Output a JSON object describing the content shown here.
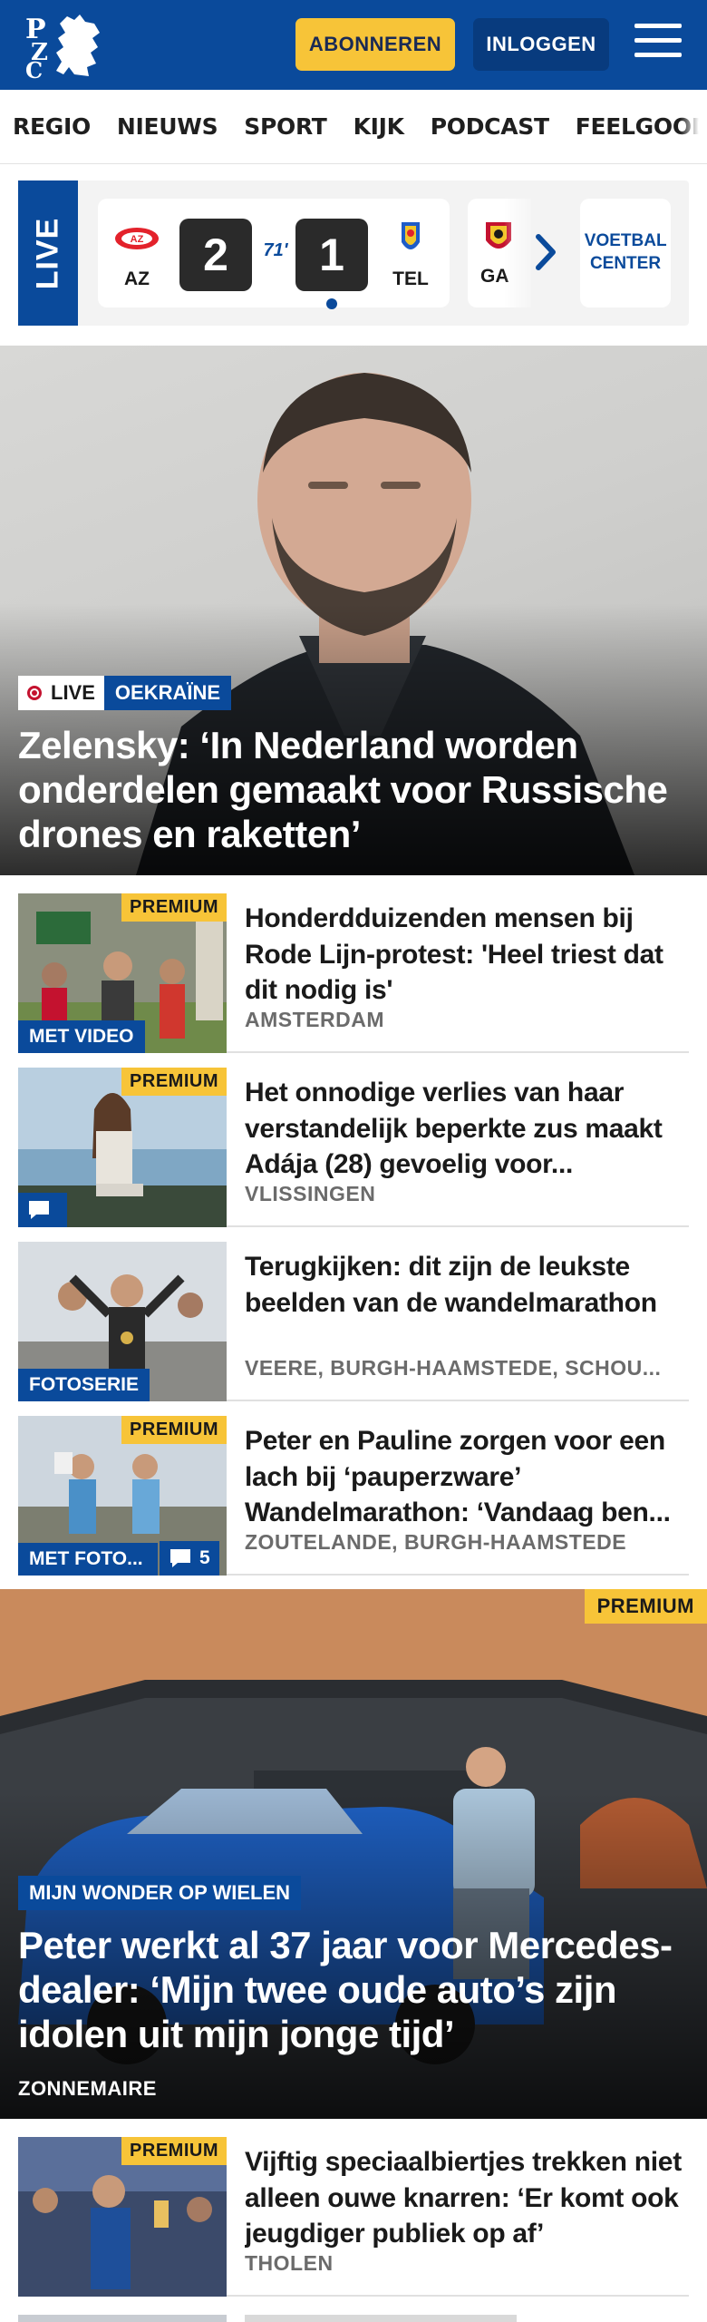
{
  "header": {
    "logo_text": "PZC",
    "subscribe_label": "ABONNEREN",
    "login_label": "INLOGGEN",
    "menu_icon": "hamburger-menu-icon"
  },
  "nav": {
    "items": [
      "REGIO",
      "NIEUWS",
      "SPORT",
      "KIJK",
      "PODCAST",
      "FEELGOOD"
    ]
  },
  "live_strip": {
    "tab_label": "LIVE",
    "match": {
      "home_abbr": "AZ",
      "home_score": "2",
      "minute": "71'",
      "away_score": "1",
      "away_abbr": "TEL"
    },
    "next_match_abbr": "GA",
    "next_icon": "chevron-right-icon",
    "voetbal_center_label": "VOETBAL CENTER"
  },
  "hero": {
    "live_label": "LIVE",
    "category": "OEKRAÏNE",
    "title": "Zelensky: ‘In Nederland worden onderdelen gemaakt voor Russische drones en raketten’"
  },
  "items": [
    {
      "premium": "PREMIUM",
      "tag": "MET VIDEO",
      "title": "Honderdduizenden mensen bij Rode Lijn-protest: 'Heel triest dat dit nodig is'",
      "location": "AMSTERDAM"
    },
    {
      "premium": "PREMIUM",
      "title": "Het onnodige verlies van haar verstandelijk beperkte zus maakt Adája (28) gevoelig voor...",
      "location": "VLISSINGEN"
    },
    {
      "tag": "FOTOSERIE",
      "title": "Terugkijken: dit zijn de leukste beelden van de wandelmarathon",
      "location": "VEERE, BURGH-HAAMSTEDE, SCHOU..."
    },
    {
      "premium": "PREMIUM",
      "tag": "MET FOTO...",
      "comments": "5",
      "title": "Peter en Pauline zorgen voor een lach bij ‘pauperzware’ Wandelmarathon: ‘Vandaag ben...",
      "location": "ZOUTELANDE, BURGH-HAAMSTEDE"
    }
  ],
  "feature": {
    "premium": "PREMIUM",
    "category": "MIJN WONDER OP WIELEN",
    "title": "Peter werkt al 37 jaar voor Mercedes-dealer: ‘Mijn twee oude auto’s zijn idolen uit mijn jonge tijd’",
    "location": "ZONNEMAIRE"
  },
  "items2": [
    {
      "premium": "PREMIUM",
      "title": "Vijftig speciaalbiertjes trekken niet alleen ouwe knarren: ‘Er komt ook jeugdiger publiek op af’",
      "location": "THOLEN"
    }
  ],
  "colors": {
    "brand_blue": "#0a4a9b",
    "premium_yellow": "#f7c438",
    "live_red": "#c4122f"
  }
}
